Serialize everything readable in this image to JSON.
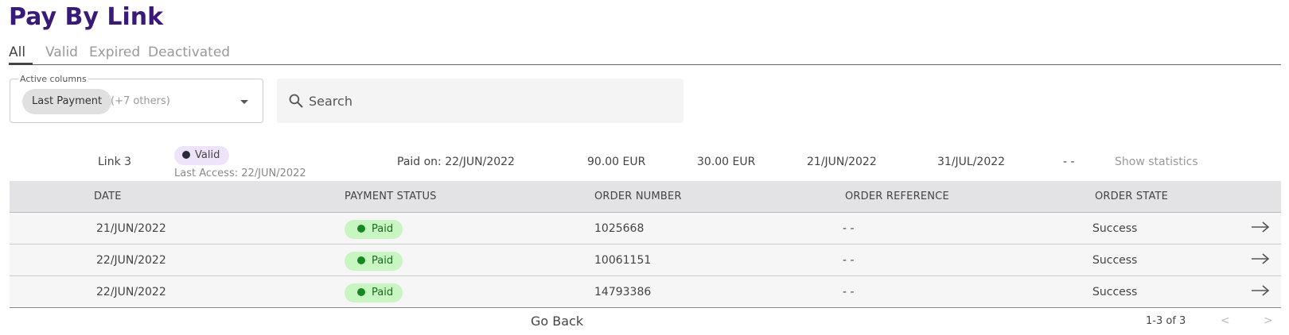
{
  "page": {
    "title": "Pay By Link"
  },
  "tabs": [
    {
      "label": "All"
    },
    {
      "label": "Valid"
    },
    {
      "label": "Expired"
    },
    {
      "label": "Deactivated"
    }
  ],
  "columns_select": {
    "legend": "Active columns",
    "selected_chip": "Last Payment",
    "others": "(+7 others)"
  },
  "search": {
    "placeholder": "Search"
  },
  "link": {
    "name": "Link 3",
    "status": "Valid",
    "last_access": "Last Access: 22/JUN/2022",
    "paid_on": "Paid on: 22/JUN/2022",
    "amount_1": "90.00 EUR",
    "amount_2": "30.00 EUR",
    "date_1": "21/JUN/2022",
    "date_2": "31/JUL/2022",
    "empty": "- -",
    "show_statistics": "Show statistics"
  },
  "table": {
    "headers": [
      "DATE",
      "PAYMENT STATUS",
      "ORDER NUMBER",
      "ORDER REFERENCE",
      "ORDER STATE"
    ],
    "rows": [
      {
        "date": "21/JUN/2022",
        "payment_status": "Paid",
        "order_number": "1025668",
        "order_reference": "- -",
        "order_state": "Success"
      },
      {
        "date": "22/JUN/2022",
        "payment_status": "Paid",
        "order_number": "10061151",
        "order_reference": "- -",
        "order_state": "Success"
      },
      {
        "date": "22/JUN/2022",
        "payment_status": "Paid",
        "order_number": "14793386",
        "order_reference": "- -",
        "order_state": "Success"
      }
    ]
  },
  "footer": {
    "go_back": "Go Back",
    "page_info": "1-3 of 3",
    "prev": "<",
    "next": ">"
  },
  "colors": {
    "title": "#3a1a78",
    "valid_badge_bg": "#efe3fa",
    "paid_badge_bg": "#c8f5c2",
    "paid_dot": "#168a22"
  },
  "icons": {
    "search": "search-icon",
    "row_arrow": "arrow-right-icon",
    "dropdown": "caret-down-icon"
  }
}
